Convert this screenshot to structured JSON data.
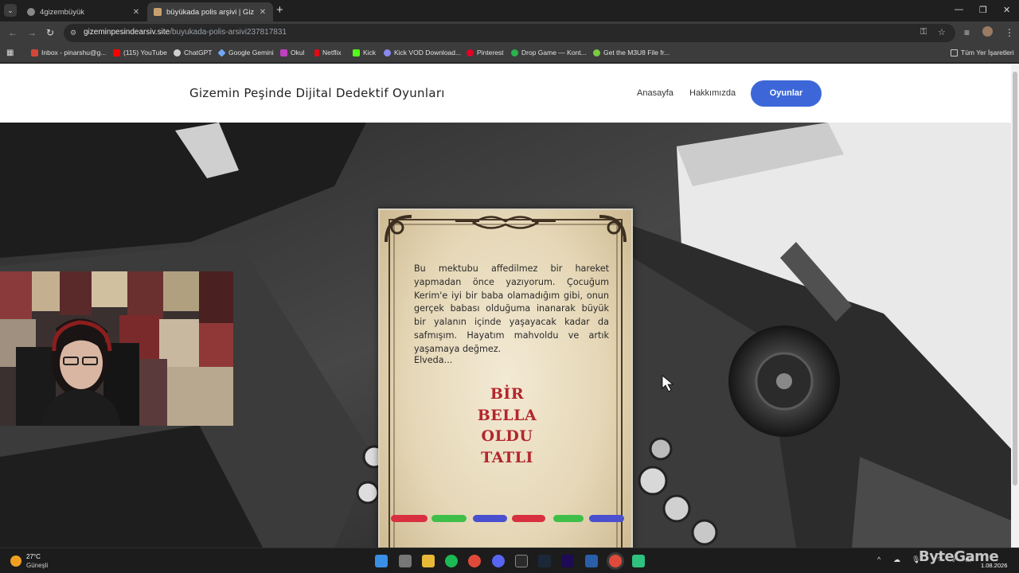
{
  "browser": {
    "tabs": [
      {
        "title": "4gizembüyük",
        "active": false
      },
      {
        "title": "büyükada polis arşivi | Gizemin",
        "active": true
      }
    ],
    "url_host": "gizeminpesindearsiv.site",
    "url_path": "/buyukada-polis-arsivi237817831",
    "bookmarks": [
      "Inbox - pinarshu@g...",
      "(115) YouTube",
      "ChatGPT",
      "Google Gemini",
      "Okul",
      "Netflix",
      "Kick",
      "Kick VOD Download...",
      "Pinterest",
      "Drop Game — Kont...",
      "Get the M3U8 File fr..."
    ],
    "all_bookmarks": "Tüm Yer İşaretleri"
  },
  "site": {
    "brand": "Gizemin Peşinde Dijital Dedektif Oyunları",
    "nav": {
      "home": "Anasayfa",
      "about": "Hakkımızda",
      "games": "Oyunlar"
    }
  },
  "letter": {
    "body": "Bu mektubu affedilmez bir hareket yapmadan önce yazıyorum. Çocuğum Kerim'e iyi bir baba olamadığım gibi, onun gerçek babası olduğuma inanarak büyük bir yalanın içinde yaşayacak kadar da safmışım. Hayatım mahvoldu ve artık yaşamaya değmez.",
    "signoff": "Elveda...",
    "riddle_lines": [
      "BİR",
      "BELLA",
      "OLDU",
      "TATLI"
    ],
    "color_strokes": [
      "#d8303f",
      "#3fbf4a",
      "#4a4fcf",
      "#d8303f",
      "#3fbf4a",
      "#4a4fcf"
    ]
  },
  "taskbar": {
    "temperature": "27°C",
    "weather": "Güneşli",
    "date": "1.08.2026"
  },
  "colors": {
    "accent": "#3d67d9",
    "riddle_red": "#b3262d"
  }
}
